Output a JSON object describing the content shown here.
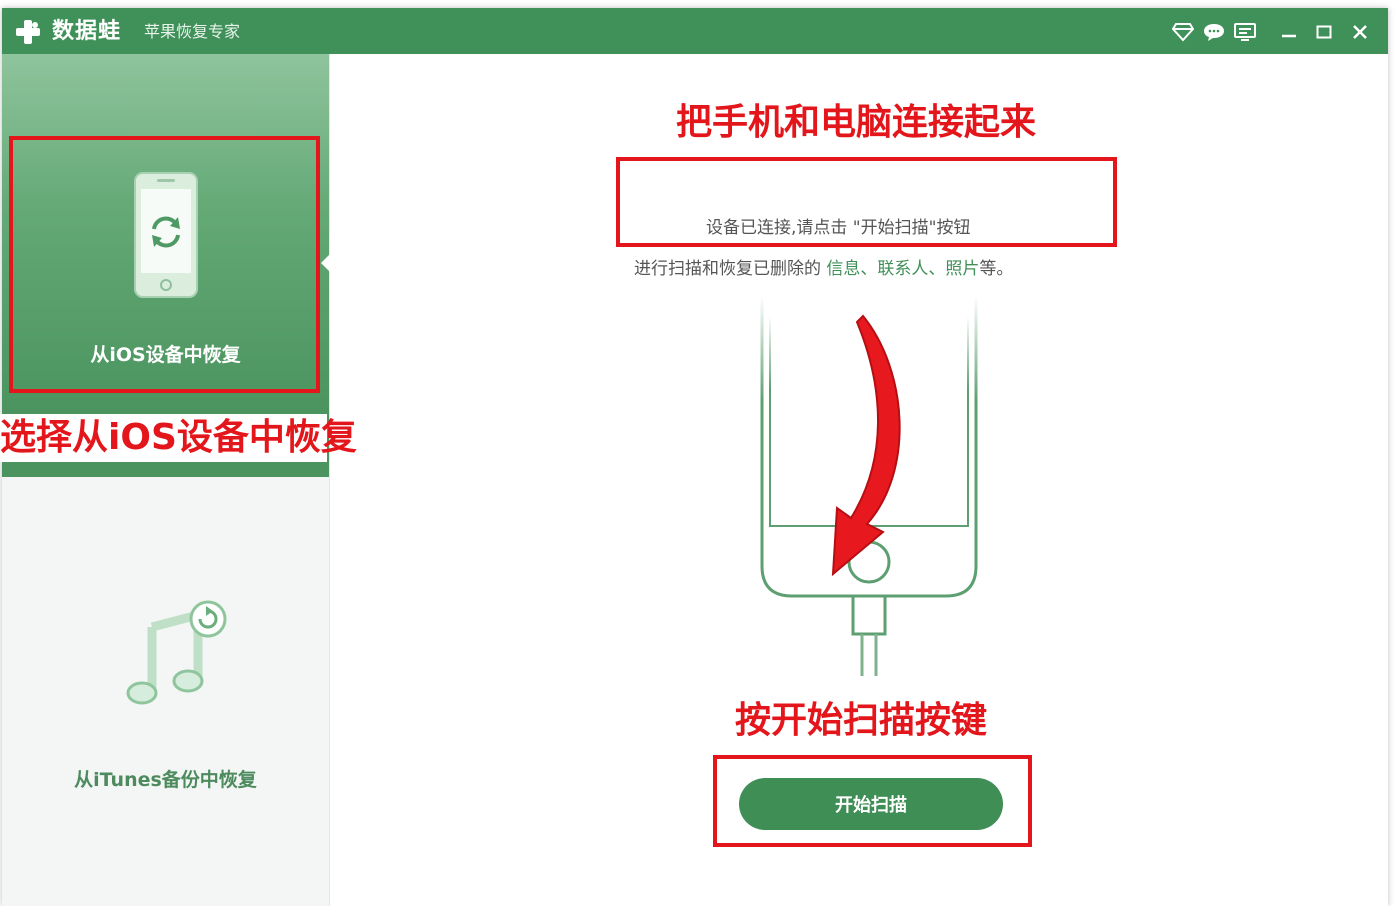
{
  "window": {
    "app_name": "数据蛙",
    "subtitle": "苹果恢复专家"
  },
  "titlebar_buttons": [
    {
      "icon": "diamond-icon"
    },
    {
      "icon": "chat-bubble-icon"
    },
    {
      "icon": "feedback-monitor-icon"
    },
    {
      "icon": "minimize-icon"
    },
    {
      "icon": "maximize-icon"
    },
    {
      "icon": "close-icon"
    }
  ],
  "sidebar": {
    "ios_item": {
      "label": "从iOS设备中恢复",
      "icon": "phone-recover-icon",
      "selected": true
    },
    "itunes_item": {
      "label": "从iTunes备份中恢复",
      "icon": "music-note-icon",
      "selected": false
    }
  },
  "main": {
    "info_line1": "设备已连接,请点击 \"开始扫描\"按钮",
    "info_line2_prefix": "进行扫描和恢复已删除的 ",
    "info_link1": "信息",
    "info_sep1": "、",
    "info_link2": "联系人",
    "info_sep2": "、",
    "info_link3": "照片",
    "info_line2_suffix": "等。",
    "start_button": "开始扫描"
  },
  "annotations": {
    "select_ios": "选择从iOS设备中恢复",
    "connect_phone": "把手机和电脑连接起来",
    "press_scan": "按开始扫描按键"
  },
  "colors": {
    "brand_green": "#3f9059",
    "annotation_red": "#e3161b"
  }
}
